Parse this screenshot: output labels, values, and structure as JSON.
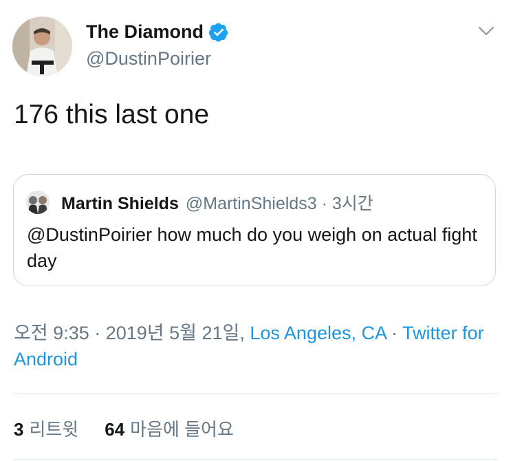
{
  "author": {
    "name": "The Diamond",
    "handle": "@DustinPoirier",
    "verified": true
  },
  "tweet": {
    "text": "176 this last one"
  },
  "quoted_tweet": {
    "name": "Martin Shields",
    "handle": "@MartinShields3",
    "separator": "·",
    "age": "3시간",
    "text": "@DustinPoirier how much do you weigh on actual fight day"
  },
  "meta": {
    "time": "오전 9:35",
    "sep1": " · ",
    "date": "2019년 5월 21일, ",
    "location": "Los Angeles, CA",
    "sep2": " · ",
    "source": "Twitter for Android"
  },
  "stats": {
    "retweets_count": "3",
    "retweets_label": "리트윗",
    "likes_count": "64",
    "likes_label": "마음에 들어요"
  },
  "colors": {
    "link": "#1b95e0",
    "secondary_text": "#657786",
    "primary_text": "#14171a",
    "border": "#ccd6dd"
  }
}
